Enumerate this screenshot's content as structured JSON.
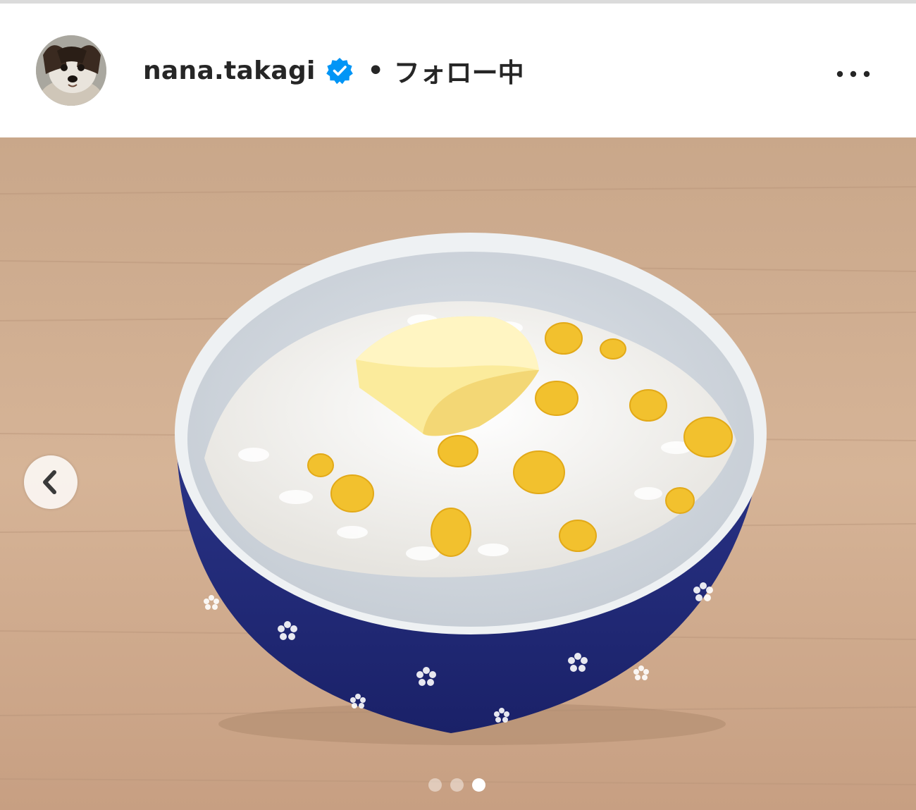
{
  "post": {
    "username": "nana.takagi",
    "verified": true,
    "separator": "•",
    "follow_status": "フォロー中",
    "more_icon": "more-horizontal-icon",
    "avatar_icon": "dog-avatar",
    "image_description_icon": "photo",
    "carousel": {
      "total": 3,
      "current": 3
    },
    "prev_icon": "chevron-left-icon"
  },
  "colors": {
    "verified_blue": "#0095f6",
    "text": "#262626",
    "border": "#dbdbdb"
  }
}
